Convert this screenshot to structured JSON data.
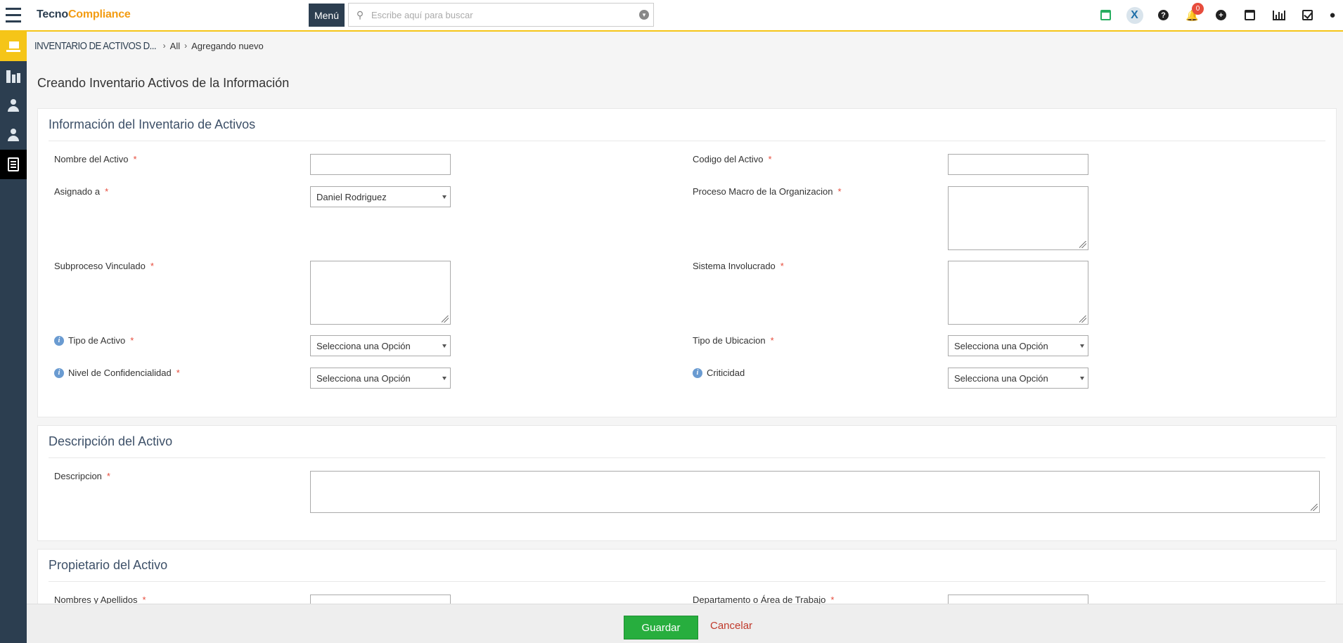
{
  "brand": {
    "part1": "Tecno",
    "part2": "Compliance"
  },
  "topbar": {
    "menu_label": "Menú",
    "search_placeholder": "Escribe aquí para buscar",
    "notification_count": "0",
    "icons": [
      "calendar-check-icon",
      "app-x-logo-icon",
      "help-icon",
      "bell-icon",
      "plus-circle-icon",
      "calendar-icon",
      "bar-chart-icon",
      "checkbox-icon",
      "user-icon"
    ]
  },
  "sidebar": {
    "items": [
      "cart-icon",
      "buildings-icon",
      "user-icon",
      "user-tie-icon",
      "document-list-icon"
    ]
  },
  "breadcrumb": {
    "module": "INVENTARIO DE ACTIVOS D...",
    "level1": "All",
    "level2": "Agregando nuevo"
  },
  "page_title": "Creando Inventario Activos de la Información",
  "section1": {
    "title": "Información del Inventario de Activos",
    "fields": {
      "nombre": {
        "label": "Nombre del Activo",
        "value": ""
      },
      "codigo": {
        "label": "Codigo del Activo",
        "value": ""
      },
      "asignado": {
        "label": "Asignado a",
        "value": "Daniel Rodriguez"
      },
      "proceso": {
        "label": "Proceso Macro de la Organizacion",
        "value": ""
      },
      "subproceso": {
        "label": "Subproceso Vinculado",
        "value": ""
      },
      "sistema": {
        "label": "Sistema Involucrado",
        "value": ""
      },
      "tipo_activo": {
        "label": "Tipo de Activo",
        "value": "Selecciona una Opción"
      },
      "tipo_ubicacion": {
        "label": "Tipo de Ubicacion",
        "value": "Selecciona una Opción"
      },
      "confidencialidad": {
        "label": "Nivel de Confidencialidad",
        "value": "Selecciona una Opción"
      },
      "criticidad": {
        "label": "Criticidad",
        "value": "Selecciona una Opción"
      }
    }
  },
  "section2": {
    "title": "Descripción del Activo",
    "fields": {
      "descripcion": {
        "label": "Descripcion",
        "value": ""
      }
    }
  },
  "section3": {
    "title": "Propietario del Activo",
    "fields": {
      "nombres": {
        "label": "Nombres y Apellidos"
      },
      "departamento": {
        "label": "Departamento o Área de Trabajo"
      }
    }
  },
  "footer": {
    "save_label": "Guardar",
    "cancel_label": "Cancelar"
  },
  "colors": {
    "accent": "#f5c518",
    "sidebar": "#2c3e50",
    "save": "#27ae3e",
    "required": "#e74c3c"
  }
}
